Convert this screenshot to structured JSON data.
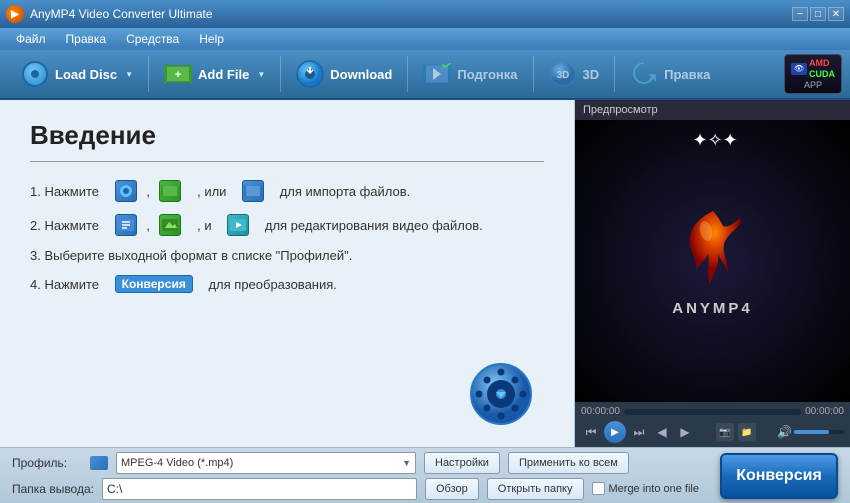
{
  "window": {
    "title": "AnyMP4 Video Converter Ultimate",
    "min_btn": "−",
    "max_btn": "□",
    "close_btn": "✕"
  },
  "menu": {
    "items": [
      "Файл",
      "Правка",
      "Средства",
      "Help"
    ]
  },
  "toolbar": {
    "load_disc": "Load Disc",
    "add_file": "Add File",
    "download": "Download",
    "edit": "Подгонка",
    "threed": "3D",
    "fix": "Правка",
    "amd_label": "AMD",
    "cuda_label": "CUDA",
    "app_label": "APP"
  },
  "intro": {
    "title": "Введение",
    "step1": "1. Нажмите",
    "step1_mid": ", или",
    "step1_end": "для импорта файлов.",
    "step2": "2. Нажмите",
    "step2_mid": ", и",
    "step2_end": "для редактирования видео файлов.",
    "step3": "3. Выберите выходной формат в списке \"Профилей\".",
    "step4_pre": "4. Нажмите",
    "step4_badge": "Конверсия",
    "step4_post": "для преобразования."
  },
  "preview": {
    "label": "Предпросмотр",
    "brand_text": "ANYMP4",
    "time_start": "00:00:00",
    "time_end": "00:00:00"
  },
  "bottom": {
    "profile_label": "Профиль:",
    "profile_value": "MPEG-4 Video (*.mp4)",
    "settings_btn": "Настройки",
    "apply_all_btn": "Применить ко всем",
    "output_label": "Папка вывода:",
    "output_value": "C:\\",
    "browse_btn": "Обзор",
    "open_folder_btn": "Открыть папку",
    "merge_label": "Merge into one file",
    "convert_btn": "Конверсия"
  }
}
